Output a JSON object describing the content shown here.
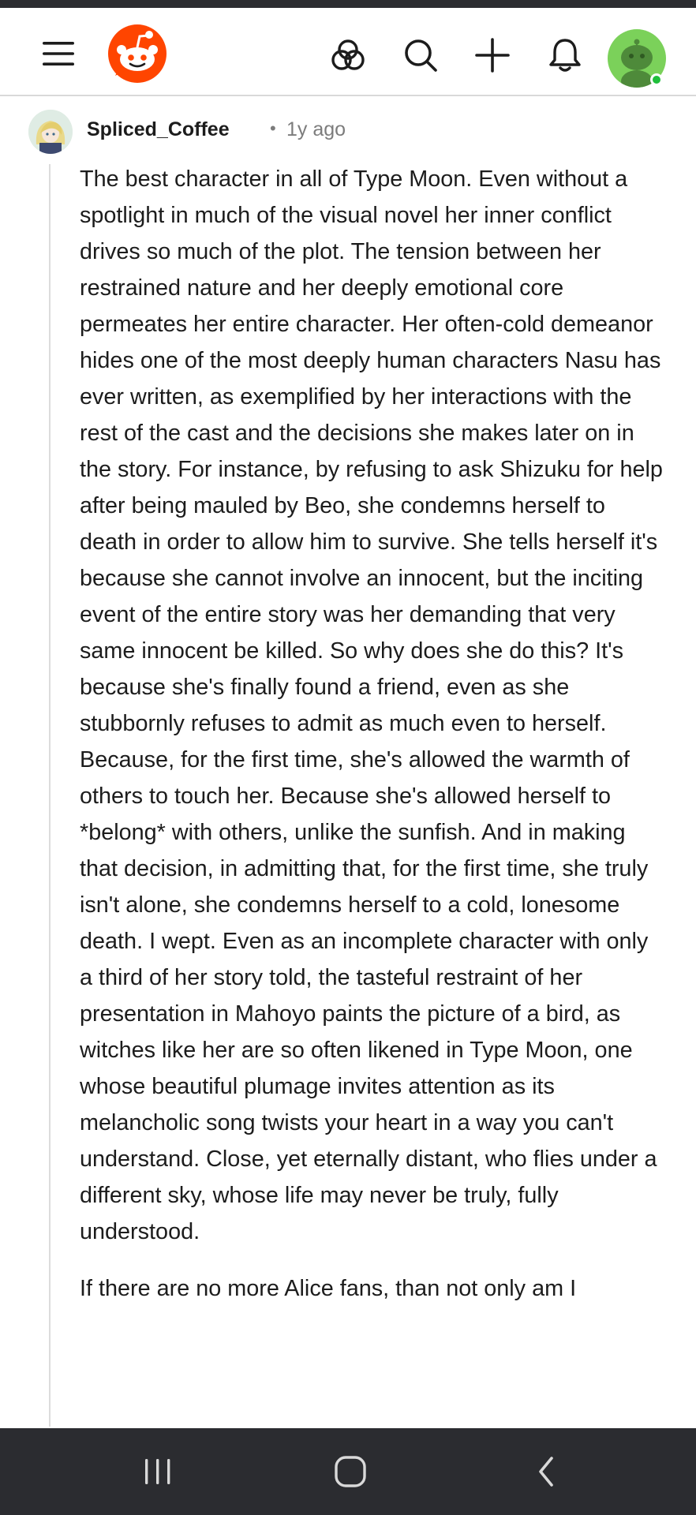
{
  "app": {
    "name": "Reddit",
    "brand_color": "#ff4500"
  },
  "header": {
    "icons": [
      "menu-icon",
      "reddit-logo",
      "communities-icon",
      "search-icon",
      "create-post-icon",
      "notifications-icon",
      "profile-avatar"
    ],
    "avatar_bg": "#7bd15a",
    "online_color": "#1fbf3b"
  },
  "comment": {
    "author": "Spliced_Coffee",
    "separator": "•",
    "timestamp": "1y ago",
    "paragraphs": [
      "The best character in all of Type Moon. Even without a spotlight in much of the visual novel her inner conflict drives so much of the plot. The tension between her restrained nature and her deeply emotional core permeates her entire character. Her often-cold demeanor hides one of the most deeply human characters Nasu has ever written, as exemplified by her interactions with the rest of the cast and the decisions she makes later on in the story. For instance, by refusing to ask Shizuku for help after being mauled by Beo, she condemns herself to death in order to allow him to survive. She tells herself it's because she cannot involve an innocent, but the inciting event of the entire story was her demanding that very same innocent be killed. So why does she do this? It's because she's finally found a friend, even as she stubbornly refuses to admit as much even to herself. Because, for the first time, she's allowed the warmth of others to touch her. Because she's allowed herself to *belong* with others, unlike the sunfish. And in making that decision, in admitting that, for the first time, she truly isn't alone, she condemns herself to a cold, lonesome death. I wept. Even as an incomplete character with only a third of her story told, the tasteful restraint of her presentation in Mahoyo paints the picture of a bird, as witches like her are so often likened in Type Moon, one whose beautiful plumage invites attention as its melancholic song twists your heart in a way you can't understand. Close, yet eternally distant, who flies under a different sky, whose life may never be truly, fully understood.",
      "If there are no more Alice fans, than not only am I"
    ]
  },
  "system_nav": {
    "icons": [
      "recent-apps-icon",
      "home-icon",
      "back-icon"
    ],
    "bg": "#2b2c30"
  }
}
